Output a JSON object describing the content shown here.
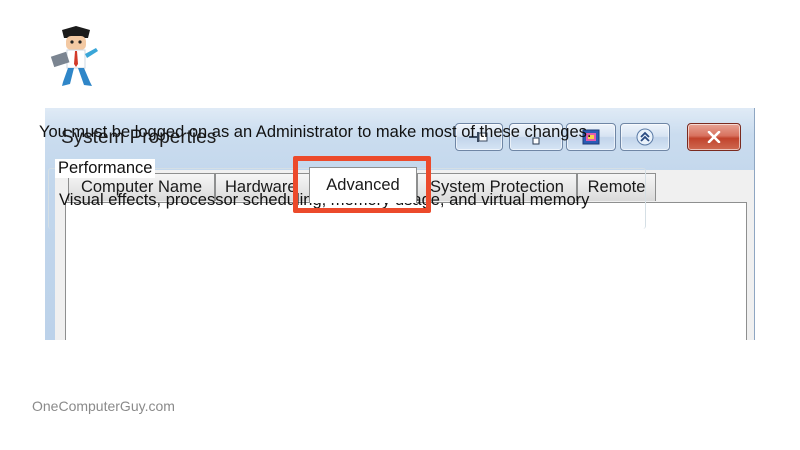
{
  "window": {
    "title": "System Properties",
    "titlebar_buttons": [
      "pin-icon",
      "minimize-icon",
      "color-picker-icon",
      "collapse-icon",
      "close-icon"
    ]
  },
  "tabs": [
    {
      "label": "Computer Name",
      "active": false
    },
    {
      "label": "Hardware",
      "active": false
    },
    {
      "label": "Advanced",
      "active": true
    },
    {
      "label": "System Protection",
      "active": false
    },
    {
      "label": "Remote",
      "active": false
    }
  ],
  "content": {
    "notice": "You must be logged on as an Administrator to make most of these changes.",
    "performance": {
      "title": "Performance",
      "description": "Visual effects, processor scheduling, memory usage, and virtual memory"
    }
  },
  "annotation": {
    "color": "#ec4a2b"
  },
  "footer": {
    "watermark": "OneComputerGuy.com"
  }
}
